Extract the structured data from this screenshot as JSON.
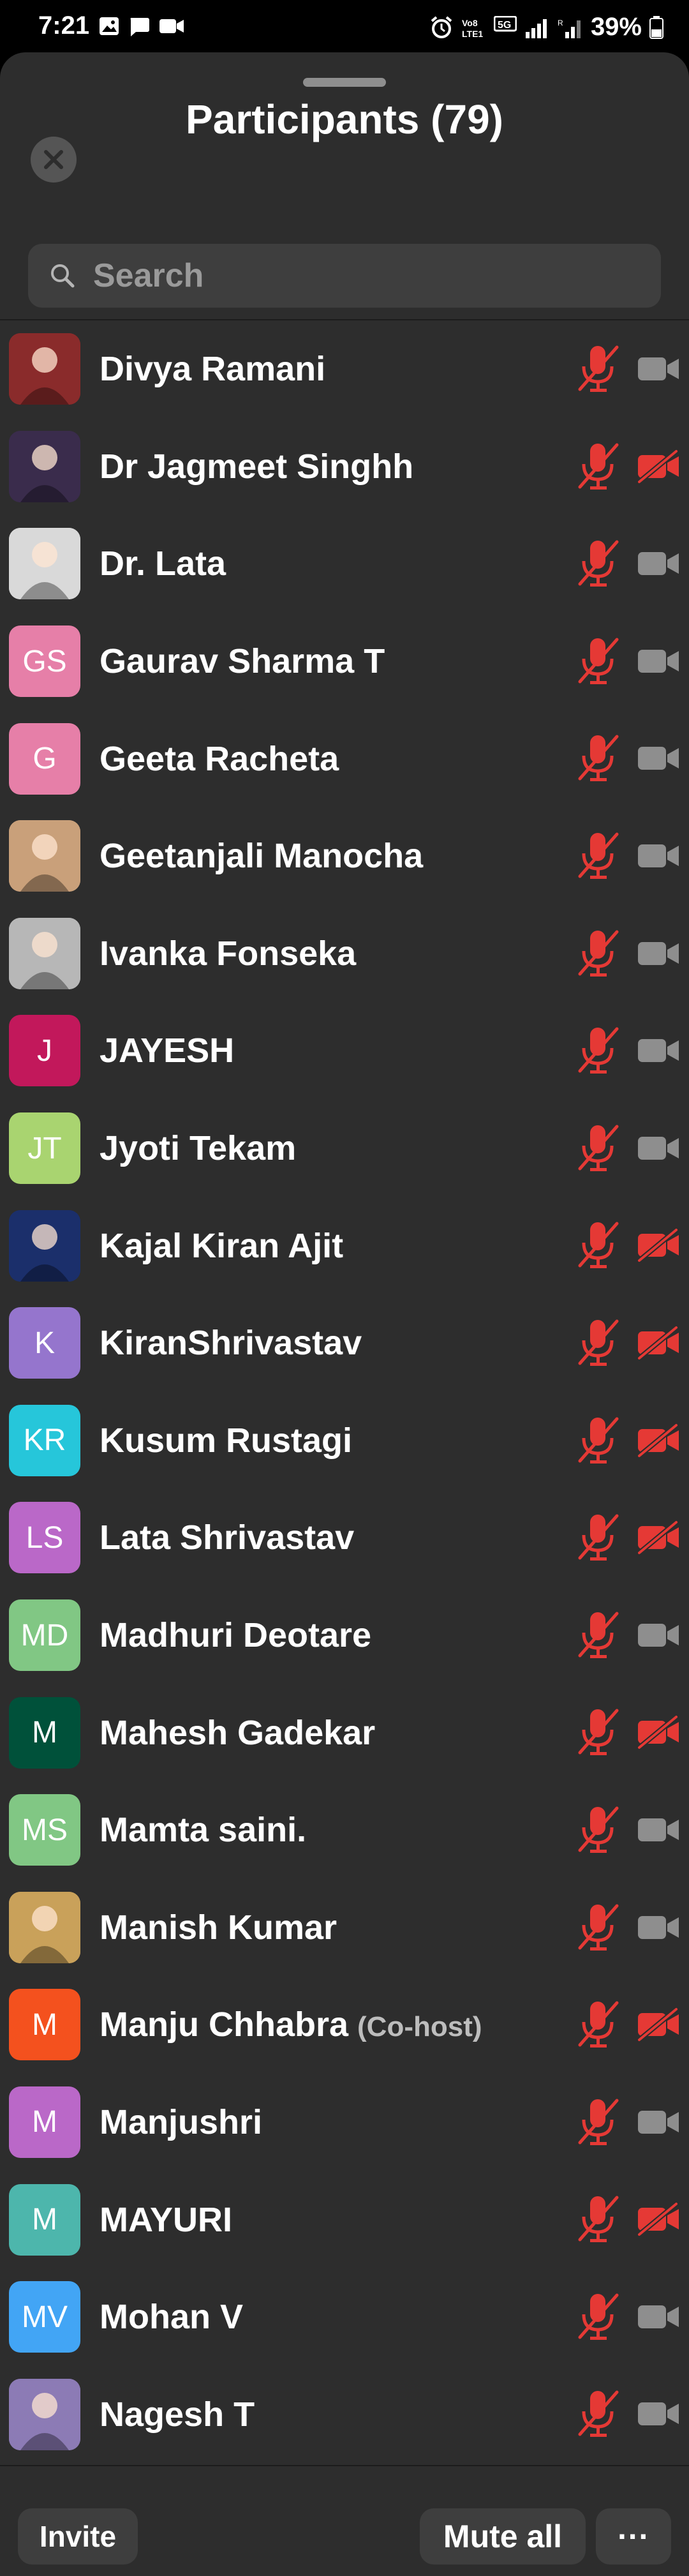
{
  "status_bar": {
    "time": "7:21",
    "battery": "39%"
  },
  "sheet": {
    "title": "Participants (79)"
  },
  "search": {
    "placeholder": "Search"
  },
  "participants": [
    {
      "name": "Divya Ramani",
      "avatar_text": "",
      "avatar_color": "#8a2b2b",
      "photo": true,
      "video_off": false,
      "cohost": ""
    },
    {
      "name": "Dr Jagmeet Singhh",
      "avatar_text": "",
      "avatar_color": "#3a2c4c",
      "photo": true,
      "video_off": true,
      "cohost": ""
    },
    {
      "name": "Dr. Lata",
      "avatar_text": "",
      "avatar_color": "#d9d9d9",
      "photo": true,
      "video_off": false,
      "cohost": ""
    },
    {
      "name": "Gaurav Sharma T",
      "avatar_text": "GS",
      "avatar_color": "#e67fa8",
      "photo": false,
      "video_off": false,
      "cohost": ""
    },
    {
      "name": "Geeta  Racheta",
      "avatar_text": "G",
      "avatar_color": "#e67fa8",
      "photo": false,
      "video_off": false,
      "cohost": ""
    },
    {
      "name": "Geetanjali Manocha",
      "avatar_text": "",
      "avatar_color": "#c9a07a",
      "photo": true,
      "video_off": false,
      "cohost": ""
    },
    {
      "name": "Ivanka Fonseka",
      "avatar_text": "",
      "avatar_color": "#b7b7b7",
      "photo": true,
      "video_off": false,
      "cohost": ""
    },
    {
      "name": "JAYESH",
      "avatar_text": "J",
      "avatar_color": "#c2185b",
      "photo": false,
      "video_off": false,
      "cohost": ""
    },
    {
      "name": "Jyoti Tekam",
      "avatar_text": "JT",
      "avatar_color": "#a9d470",
      "photo": false,
      "video_off": false,
      "cohost": ""
    },
    {
      "name": "Kajal Kiran Ajit",
      "avatar_text": "",
      "avatar_color": "#1b2f6b",
      "photo": true,
      "video_off": true,
      "cohost": ""
    },
    {
      "name": "KiranShrivastav",
      "avatar_text": "K",
      "avatar_color": "#9575cd",
      "photo": false,
      "video_off": true,
      "cohost": ""
    },
    {
      "name": "Kusum Rustagi",
      "avatar_text": "KR",
      "avatar_color": "#26c6da",
      "photo": false,
      "video_off": true,
      "cohost": ""
    },
    {
      "name": "Lata Shrivastav",
      "avatar_text": "LS",
      "avatar_color": "#ba68c8",
      "photo": false,
      "video_off": true,
      "cohost": ""
    },
    {
      "name": "Madhuri Deotare",
      "avatar_text": "MD",
      "avatar_color": "#81c784",
      "photo": false,
      "video_off": false,
      "cohost": ""
    },
    {
      "name": "Mahesh Gadekar",
      "avatar_text": "M",
      "avatar_color": "#00513a",
      "photo": false,
      "video_off": true,
      "cohost": ""
    },
    {
      "name": "Mamta saini.",
      "avatar_text": "MS",
      "avatar_color": "#81c784",
      "photo": false,
      "video_off": false,
      "cohost": ""
    },
    {
      "name": "Manish Kumar",
      "avatar_text": "",
      "avatar_color": "#c9a15a",
      "photo": true,
      "video_off": false,
      "cohost": ""
    },
    {
      "name": "Manju Chhabra",
      "avatar_text": "M",
      "avatar_color": "#f4511e",
      "photo": false,
      "video_off": true,
      "cohost": "(Co-host)"
    },
    {
      "name": "Manjushri",
      "avatar_text": "M",
      "avatar_color": "#ba68c8",
      "photo": false,
      "video_off": false,
      "cohost": ""
    },
    {
      "name": "MAYURI",
      "avatar_text": "M",
      "avatar_color": "#4db6ac",
      "photo": false,
      "video_off": true,
      "cohost": ""
    },
    {
      "name": "Mohan V",
      "avatar_text": "MV",
      "avatar_color": "#42a5f5",
      "photo": false,
      "video_off": false,
      "cohost": ""
    },
    {
      "name": "Nagesh T",
      "avatar_text": "",
      "avatar_color": "#8c7bb5",
      "photo": true,
      "video_off": false,
      "cohost": ""
    }
  ],
  "bottom_bar": {
    "invite_label": "Invite",
    "mute_all_label": "Mute all",
    "more_label": "···"
  },
  "colors": {
    "muted_red": "#e53935",
    "camera_gray": "#8e8e8e",
    "sheet_bg": "#2d2d2d"
  }
}
